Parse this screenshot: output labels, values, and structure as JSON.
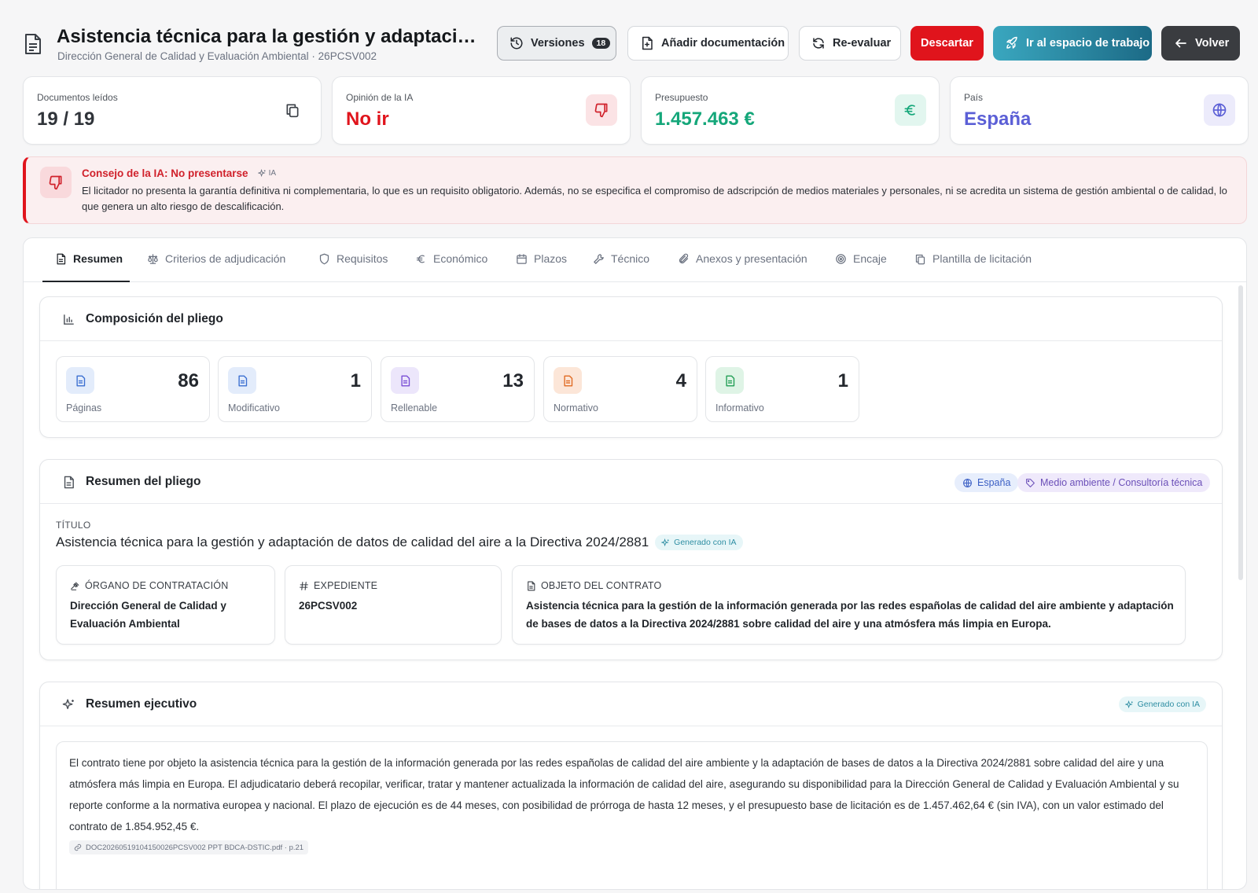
{
  "header": {
    "title": "Asistencia técnica para la gestión y adaptación...",
    "subtitle": "Dirección General de Calidad y Evaluación Ambiental · 26PCSV002",
    "buttons": {
      "versions": "Versiones",
      "versions_count": "18",
      "add_docs": "Añadir documentación",
      "reevaluate": "Re-evaluar",
      "discard": "Descartar",
      "workspace": "Ir al espacio de trabajo",
      "back": "Volver"
    }
  },
  "stats": [
    {
      "label": "Documentos leídos",
      "value": "19 / 19",
      "icon": "copy-icon",
      "color": "#30343a"
    },
    {
      "label": "Opinión de la IA",
      "value": "No ir",
      "icon": "thumbs-down-icon",
      "color": "#e0141c"
    },
    {
      "label": "Presupuesto",
      "value": "1.457.463 €",
      "icon": "euro-icon",
      "color": "#15a77a"
    },
    {
      "label": "País",
      "value": "España",
      "icon": "globe-icon",
      "color": "#5b5fd6"
    }
  ],
  "alert": {
    "title": "Consejo de la IA: No presentarse",
    "tag": "IA",
    "body": "El licitador no presenta la garantía definitiva ni complementaria, lo que es un requisito obligatorio. Además, no se especifica el compromiso de adscripción de medios materiales y personales, ni se acredita un sistema de gestión ambiental o de calidad, lo que genera un alto riesgo de descalificación."
  },
  "tabs": [
    "Resumen",
    "Criterios de adjudicación",
    "Requisitos",
    "Económico",
    "Plazos",
    "Técnico",
    "Anexos y presentación",
    "Encaje",
    "Plantilla de licitación"
  ],
  "composition": {
    "title": "Composición del pliego",
    "items": [
      {
        "value": "86",
        "label": "Páginas"
      },
      {
        "value": "1",
        "label": "Modificativo"
      },
      {
        "value": "13",
        "label": "Rellenable"
      },
      {
        "value": "4",
        "label": "Normativo"
      },
      {
        "value": "1",
        "label": "Informativo"
      }
    ]
  },
  "summary": {
    "title": "Resumen del pliego",
    "chip_country": "España",
    "chip_sector": "Medio ambiente / Consultoría técnica",
    "title_label": "TÍTULO",
    "contract_title": "Asistencia técnica para la gestión y adaptación de datos de calidad del aire a la Directiva 2024/2881",
    "ai_badge": "Generado con IA",
    "organ_label": "ÓRGANO DE CONTRATACIÓN",
    "organ_value": "Dirección General de Calidad y Evaluación Ambiental",
    "file_label": "EXPEDIENTE",
    "file_value": "26PCSV002",
    "object_label": "OBJETO DEL CONTRATO",
    "object_value": "Asistencia técnica para la gestión de la información generada por las redes españolas de calidad del aire ambiente y adaptación de bases de datos a la Directiva 2024/2881 sobre calidad del aire y una atmósfera más limpia en Europa."
  },
  "executive": {
    "title": "Resumen ejecutivo",
    "ai_badge": "Generado con IA",
    "body": "El contrato tiene por objeto la asistencia técnica para la gestión de la información generada por las redes españolas de calidad del aire ambiente y la adaptación de bases de datos a la Directiva 2024/2881 sobre calidad del aire y una atmósfera más limpia en Europa. El adjudicatario deberá recopilar, verificar, tratar y mantener actualizada la información de calidad del aire, asegurando su disponibilidad para la Dirección General de Calidad y Evaluación Ambiental y su reporte conforme a la normativa europea y nacional. El plazo de ejecución es de 44 meses, con posibilidad de prórroga de hasta 12 meses, y el presupuesto base de licitación es de 1.457.462,64 € (sin IVA), con un valor estimado del contrato de 1.854.952,45 €.",
    "source": "DOC20260519104150026PCSV002 PPT BDCA-DSTIC.pdf · p.21"
  }
}
